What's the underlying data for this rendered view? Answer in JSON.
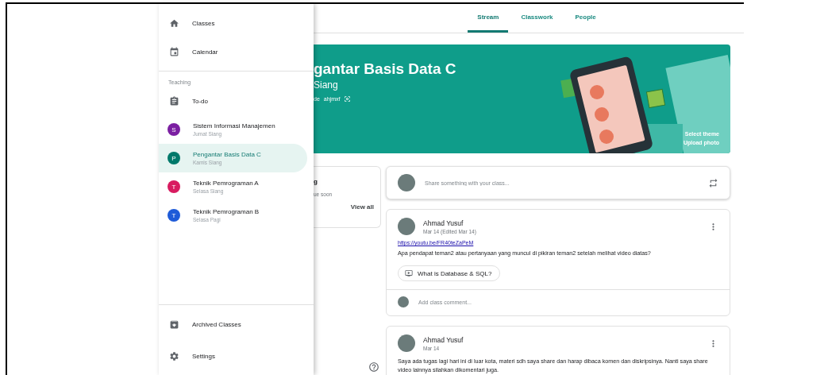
{
  "drawer": {
    "nav": [
      {
        "label": "Classes"
      },
      {
        "label": "Calendar"
      }
    ],
    "section_label": "Teaching",
    "todo": {
      "label": "To-do"
    },
    "classes": [
      {
        "initial": "S",
        "name": "Sistem Informasi Manajemen",
        "subtitle": "Jumat Siang",
        "color": "#7b1fa2",
        "selected": false
      },
      {
        "initial": "P",
        "name": "Pengantar Basis Data C",
        "subtitle": "Kamis Siang",
        "color": "#00796b",
        "selected": true
      },
      {
        "initial": "T",
        "name": "Teknik Pemrograman A",
        "subtitle": "Selasa Siang",
        "color": "#d81b60",
        "selected": false
      },
      {
        "initial": "T",
        "name": "Teknik Pemrograman B",
        "subtitle": "Selasa Pagi",
        "color": "#1e5bd8",
        "selected": false
      }
    ],
    "archived": {
      "label": "Archived Classes"
    },
    "settings": {
      "label": "Settings"
    }
  },
  "tabs": [
    {
      "label": "Stream",
      "selected": true
    },
    {
      "label": "Classwork",
      "selected": false
    },
    {
      "label": "People",
      "selected": false
    }
  ],
  "banner": {
    "title": "gantar Basis Data C",
    "subtitle": "Siang",
    "code_label": "de",
    "code": "ahjmxf",
    "select_theme": "Select theme",
    "upload_photo": "Upload photo"
  },
  "upcoming": {
    "title": "g",
    "note": "ue soon",
    "view_all": "View all"
  },
  "share": {
    "placeholder": "Share something with your class..."
  },
  "posts": [
    {
      "author": "Ahmad Yusuf",
      "date": "Mar 14 (Edited Mar 14)",
      "link": "https://youtu.be/FR40teZaPeM",
      "text": "Apa pendapat teman2 atau pertanyaan yang muncul di pikiran teman2 setelah melihat video diatas?",
      "attachment": "What is Database & SQL?",
      "comment_placeholder": "Add class comment..."
    },
    {
      "author": "Ahmad Yusuf",
      "date": "Mar 14",
      "text": "Saya ada tugas lagi hari ini di luar kota, materi sdh saya share dan harap dibaca komen dan diskripsinya. Nanti saya share video lainnya silahkan dikomentari juga."
    }
  ]
}
